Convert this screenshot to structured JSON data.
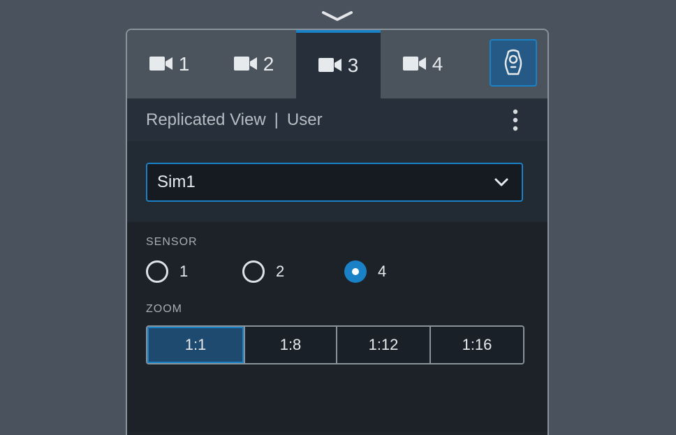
{
  "camera_tabs": [
    {
      "label": "1",
      "icon": "video-camera-icon",
      "active": false
    },
    {
      "label": "2",
      "icon": "video-camera-icon",
      "active": false
    },
    {
      "label": "3",
      "icon": "video-camera-icon",
      "active": true
    },
    {
      "label": "4",
      "icon": "video-camera-icon",
      "active": false
    }
  ],
  "sensor_view_button": {
    "icon": "sensor-device-icon"
  },
  "header": {
    "view_mode": "Replicated View",
    "separator": "|",
    "role": "User",
    "menu_icon": "kebab-menu-icon"
  },
  "sim_select": {
    "value": "Sim1",
    "icon": "chevron-down-icon"
  },
  "sensor": {
    "label": "SENSOR",
    "options": [
      {
        "label": "1",
        "selected": false
      },
      {
        "label": "2",
        "selected": false
      },
      {
        "label": "4",
        "selected": true
      }
    ]
  },
  "zoom": {
    "label": "ZOOM",
    "options": [
      {
        "label": "1:1",
        "selected": true
      },
      {
        "label": "1:8",
        "selected": false
      },
      {
        "label": "1:12",
        "selected": false
      },
      {
        "label": "1:16",
        "selected": false
      }
    ]
  },
  "colors": {
    "accent": "#1b81c7",
    "background": "#4a535d",
    "panel": "#1e242b"
  }
}
